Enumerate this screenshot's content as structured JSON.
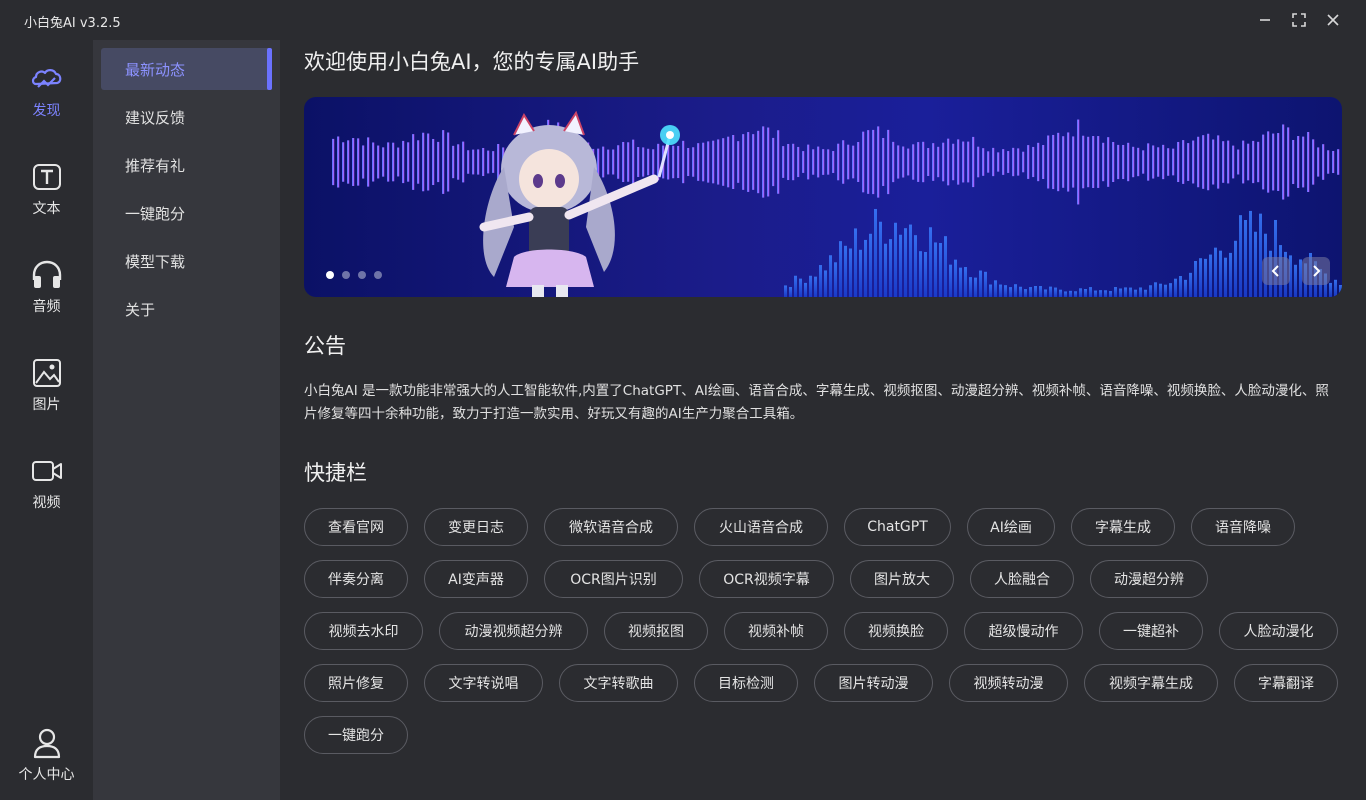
{
  "app": {
    "title": "小白兔AI v3.2.5"
  },
  "rail": {
    "items": [
      {
        "label": "发现",
        "icon": "cloud-icon",
        "active": true
      },
      {
        "label": "文本",
        "icon": "text-icon"
      },
      {
        "label": "音频",
        "icon": "headphones-icon"
      },
      {
        "label": "图片",
        "icon": "image-icon"
      },
      {
        "label": "视频",
        "icon": "video-icon"
      }
    ],
    "user": {
      "label": "个人中心",
      "icon": "user-icon"
    }
  },
  "subnav": {
    "items": [
      {
        "label": "最新动态",
        "active": true
      },
      {
        "label": "建议反馈"
      },
      {
        "label": "推荐有礼"
      },
      {
        "label": "一键跑分"
      },
      {
        "label": "模型下载"
      },
      {
        "label": "关于"
      }
    ]
  },
  "main": {
    "welcome": "欢迎使用小白兔AI，您的专属AI助手",
    "banner": {
      "slides": 4,
      "current": 1
    },
    "notice_title": "公告",
    "notice_text": "小白兔AI 是一款功能非常强大的人工智能软件,内置了ChatGPT、AI绘画、语音合成、字幕生成、视频抠图、动漫超分辨、视频补帧、语音降噪、视频换脸、人脸动漫化、照片修复等四十余种功能，致力于打造一款实用、好玩又有趣的AI生产力聚合工具箱。",
    "shortcuts_title": "快捷栏",
    "shortcuts": [
      [
        "查看官网",
        "变更日志",
        "微软语音合成",
        "火山语音合成",
        "ChatGPT",
        "AI绘画",
        "字幕生成",
        "语音降噪"
      ],
      [
        "伴奏分离",
        "AI变声器",
        "OCR图片识别",
        "OCR视频字幕",
        "图片放大",
        "人脸融合",
        "动漫超分辨"
      ],
      [
        "视频去水印",
        "动漫视频超分辨",
        "视频抠图",
        "视频补帧",
        "视频换脸",
        "超级慢动作",
        "一键超补",
        "人脸动漫化"
      ],
      [
        "照片修复",
        "文字转说唱",
        "文字转歌曲",
        "目标检测",
        "图片转动漫",
        "视频转动漫",
        "视频字幕生成",
        "字幕翻译"
      ],
      [
        "一键跑分"
      ]
    ]
  },
  "colors": {
    "accent": "#7c83ff",
    "background": "#2b2c30",
    "sidebar": "#36373d"
  }
}
